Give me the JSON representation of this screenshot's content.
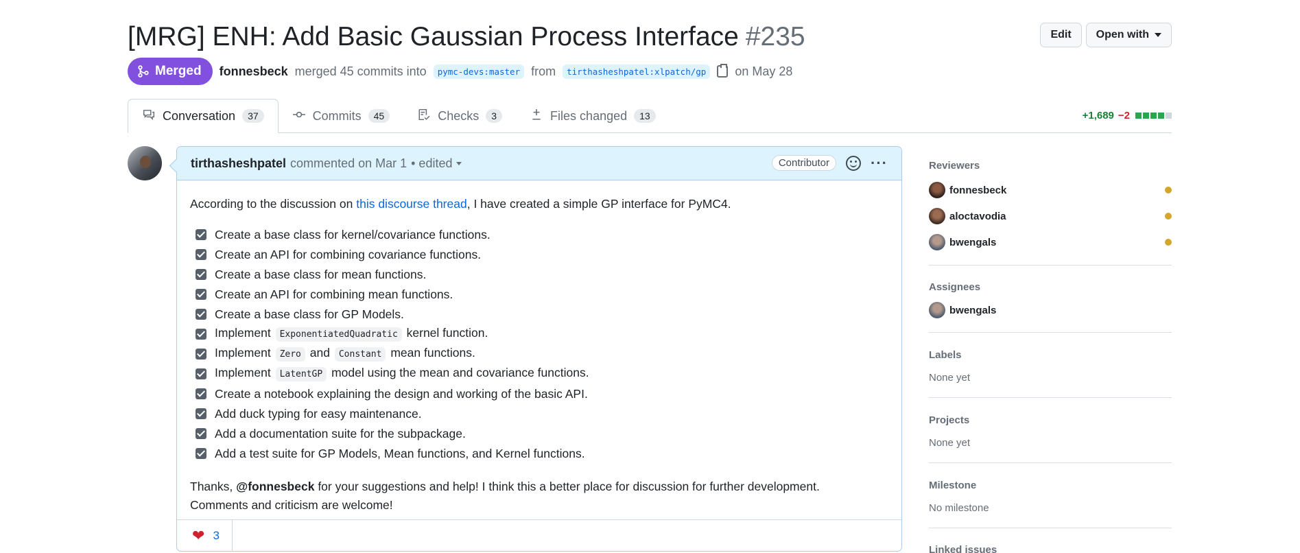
{
  "pr": {
    "title": "[MRG] ENH: Add Basic Gaussian Process Interface",
    "number": "#235",
    "state": "Merged",
    "author": "fonnesbeck",
    "merged_text": "merged 45 commits into",
    "base_branch": "pymc-devs:master",
    "from_text": "from",
    "head_branch": "tirthasheshpatel:xlpatch/gp",
    "date_text": "on May 28"
  },
  "actions": {
    "edit": "Edit",
    "open_with": "Open with"
  },
  "tabs": [
    {
      "label": "Conversation",
      "count": "37"
    },
    {
      "label": "Commits",
      "count": "45"
    },
    {
      "label": "Checks",
      "count": "3"
    },
    {
      "label": "Files changed",
      "count": "13"
    }
  ],
  "diffstat": {
    "additions": "+1,689",
    "deletions": "−2",
    "blocks": [
      "#2da44e",
      "#2da44e",
      "#2da44e",
      "#2da44e",
      "#d0d7de"
    ]
  },
  "comment": {
    "author": "tirthasheshpatel",
    "meta": "commented on Mar 1",
    "edited": "• edited",
    "role": "Contributor",
    "intro_before": "According to the discussion on ",
    "intro_link": "this discourse thread",
    "intro_after": ", I have created a simple GP interface for PyMC4.",
    "tasks": [
      {
        "pre": "Create a base class for kernel/covariance functions."
      },
      {
        "pre": "Create an API for combining covariance functions."
      },
      {
        "pre": "Create a base class for mean functions."
      },
      {
        "pre": "Create an API for combining mean functions."
      },
      {
        "pre": "Create a base class for GP Models."
      },
      {
        "pre": "Implement",
        "code1": "ExponentiatedQuadratic",
        "post": "kernel function."
      },
      {
        "pre": "Implement",
        "code1": "Zero",
        "mid": "and",
        "code2": "Constant",
        "post": "mean functions."
      },
      {
        "pre": "Implement",
        "code1": "LatentGP",
        "post": "model using the mean and covariance functions."
      },
      {
        "pre": "Create a notebook explaining the design and working of the basic API."
      },
      {
        "pre": "Add duck typing for easy maintenance."
      },
      {
        "pre": "Add a documentation suite for the subpackage."
      },
      {
        "pre": "Add a test suite for GP Models, Mean functions, and Kernel functions."
      }
    ],
    "thanks_before": "Thanks, ",
    "thanks_mention": "@fonnesbeck",
    "thanks_after": " for your suggestions and help! I think this a better place for discussion for further development.",
    "thanks_line2": "Comments and criticism are welcome!",
    "reaction_count": "3"
  },
  "sidebar": {
    "reviewers_title": "Reviewers",
    "reviewers": [
      {
        "name": "fonnesbeck",
        "status_color": "#d4a72c"
      },
      {
        "name": "aloctavodia",
        "status_color": "#d4a72c"
      },
      {
        "name": "bwengals",
        "status_color": "#d4a72c"
      }
    ],
    "assignees_title": "Assignees",
    "assignees": [
      {
        "name": "bwengals"
      }
    ],
    "labels_title": "Labels",
    "labels_value": "None yet",
    "projects_title": "Projects",
    "projects_value": "None yet",
    "milestone_title": "Milestone",
    "milestone_value": "No milestone",
    "linked_title": "Linked issues"
  },
  "colors": {
    "merged": "#8250df",
    "link": "#0969da",
    "pending": "#d4a72c"
  },
  "icons": [
    "merge-icon",
    "copy-icon",
    "comment-icon",
    "commit-icon",
    "checklist-icon",
    "diff-icon",
    "smiley-icon",
    "kebab-icon",
    "heart-icon"
  ]
}
